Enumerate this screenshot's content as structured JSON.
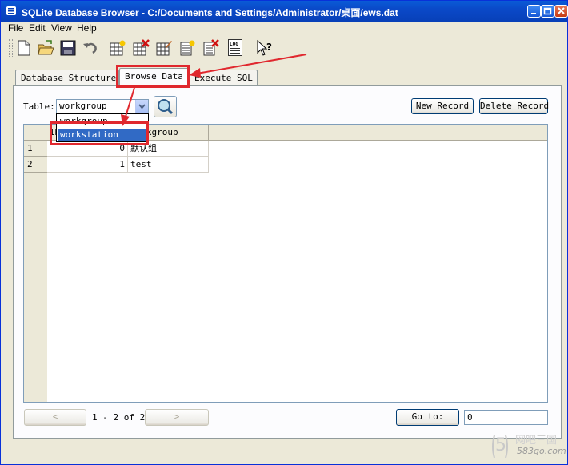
{
  "window": {
    "title": "SQLite Database Browser - C:/Documents and Settings/Administrator/桌面/ews.dat"
  },
  "menu": {
    "items": [
      {
        "label": "File"
      },
      {
        "label": "Edit"
      },
      {
        "label": "View"
      },
      {
        "label": "Help"
      }
    ]
  },
  "toolbar": {
    "icons": [
      "new-file-icon",
      "open-folder-icon",
      "save-icon",
      "undo-icon",
      "create-table-icon",
      "delete-table-icon",
      "modify-table-icon",
      "create-index-icon",
      "delete-index-icon",
      "log-icon",
      "whats-this-icon"
    ],
    "log_text": "LOG"
  },
  "tabs": [
    {
      "label": "Database Structure"
    },
    {
      "label": "Browse Data"
    },
    {
      "label": "Execute SQL"
    }
  ],
  "browse": {
    "table_label": "Table:",
    "table_selected": "workgroup",
    "table_options": [
      "workgroup",
      "workstation"
    ],
    "highlighted_option": "workstation",
    "new_record": "New Record",
    "delete_record": "Delete Record"
  },
  "grid": {
    "columns": [
      "ID",
      "workgroup"
    ],
    "rows": [
      {
        "num": "1",
        "id": "0",
        "name": "默认组"
      },
      {
        "num": "2",
        "id": "1",
        "name": "test"
      }
    ]
  },
  "pager": {
    "prev": "<",
    "next": ">",
    "status": "1 - 2 of 2",
    "goto_label": "Go to:",
    "goto_value": "0"
  },
  "watermark": {
    "logo_char": "5",
    "text": "网吧三国",
    "url": "583go.com"
  },
  "colors": {
    "titlebar": "#0a49c8",
    "annotation": "#e0282e",
    "selection": "#316ac5"
  }
}
